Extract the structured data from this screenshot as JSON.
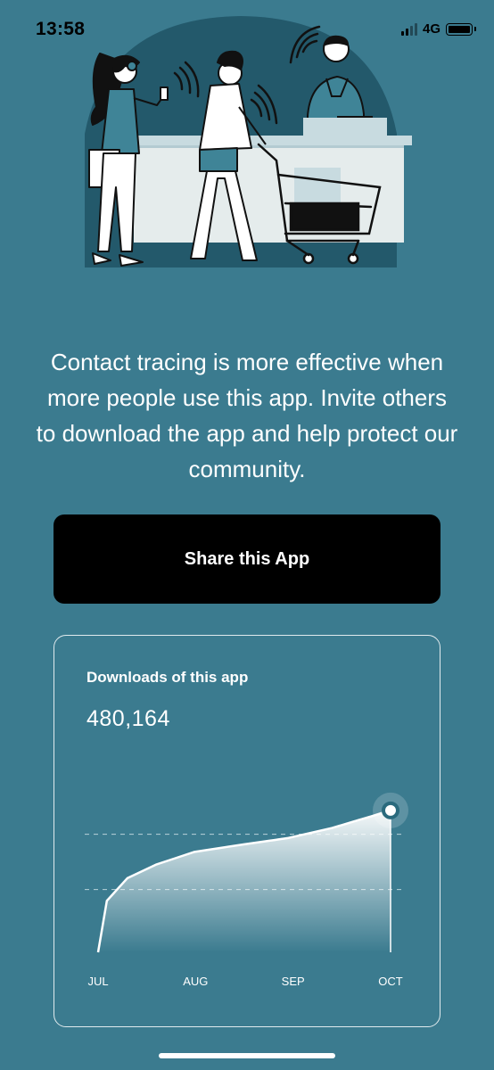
{
  "status_bar": {
    "time": "13:58",
    "network": "4G",
    "icons": [
      "signal-icon",
      "battery-icon"
    ]
  },
  "illustration": {
    "subject": "people-queuing-at-checkout"
  },
  "intro": {
    "text": "Contact tracing is more effective when more people use this app. Invite others to download the app and help protect our community."
  },
  "share_button": {
    "label": "Share this App"
  },
  "downloads_card": {
    "title": "Downloads of this app",
    "value": "480,164"
  },
  "chart_data": {
    "type": "area",
    "categories": [
      "JUL",
      "AUG",
      "SEP",
      "OCT"
    ],
    "grid": "dashed-horizontal",
    "series": [
      {
        "values": [
          {
            "x": 0.0,
            "y": 0.0
          },
          {
            "x": 0.03,
            "y": 0.41
          },
          {
            "x": 0.1,
            "y": 0.59
          },
          {
            "x": 0.2,
            "y": 0.7
          },
          {
            "x": 0.33,
            "y": 0.8
          },
          {
            "x": 0.5,
            "y": 0.86
          },
          {
            "x": 0.65,
            "y": 0.91
          },
          {
            "x": 0.8,
            "y": 0.99
          },
          {
            "x": 0.93,
            "y": 1.08
          },
          {
            "x": 1.0,
            "y": 1.13
          }
        ]
      }
    ],
    "colors": {
      "line": "#ffffff",
      "area_top": "#ffffff",
      "grid": "#b9d2da"
    }
  }
}
